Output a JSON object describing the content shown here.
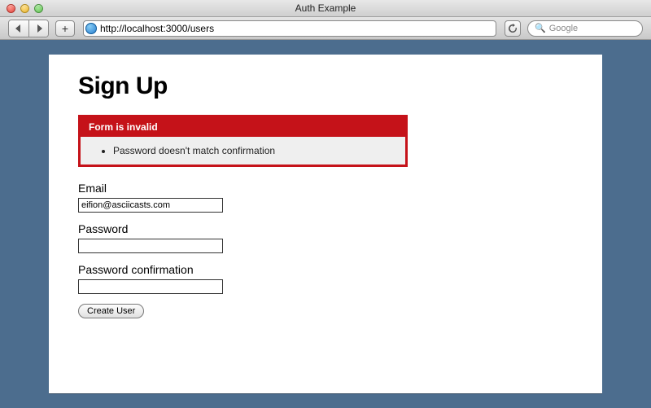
{
  "window": {
    "title": "Auth Example"
  },
  "toolbar": {
    "url": "http://localhost:3000/users",
    "search_placeholder": "Google"
  },
  "page": {
    "heading": "Sign Up",
    "error": {
      "title": "Form is invalid",
      "messages": [
        "Password doesn't match confirmation"
      ]
    },
    "form": {
      "email_label": "Email",
      "email_value": "eifion@asciicasts.com",
      "password_label": "Password",
      "password_value": "",
      "confirmation_label": "Password confirmation",
      "confirmation_value": "",
      "submit_label": "Create User"
    }
  }
}
